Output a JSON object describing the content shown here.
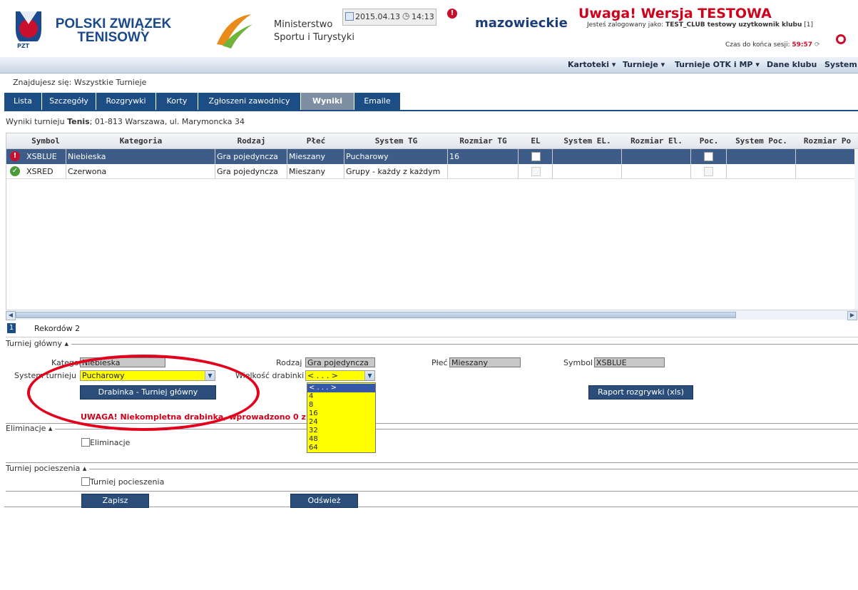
{
  "header": {
    "pzt_line1": "POLSKI ZWIĄZEK",
    "pzt_line2": "TENISOWY",
    "pzt_badge": "PZT",
    "ministry_line1": "Ministerstwo",
    "ministry_line2": "Sportu i Turystyki",
    "date": "2015.04.13",
    "time": "14:13",
    "region": "mazowieckie",
    "warning": "Uwaga! Wersja TESTOWA",
    "logged_prefix": "Jesteś zalogowany jako:",
    "logged_user": "TEST_CLUB testowy uzytkownik klubu",
    "logged_suffix": "[1]",
    "session_label": "Czas do końca sesji:",
    "session_time": "59:57"
  },
  "menu": [
    "Kartoteki ▾",
    "Turnieje ▾",
    "Turnieje OTK i MP ▾",
    "Dane klubu",
    "System"
  ],
  "breadcrumb": "Znajdujesz się: Wszystkie Turnieje",
  "tabs": [
    "Lista",
    "Szczegóły",
    "Rozgrywki",
    "Korty",
    "Zgłoszeni zawodnicy",
    "Wyniki",
    "Emaile"
  ],
  "tabs_active": "Wyniki",
  "info": {
    "prefix": "Wyniki turnieju ",
    "name": "Tenis",
    "suffix": "; 01-813 Warszawa, ul. Marymoncka 34"
  },
  "grid": {
    "columns": [
      "Symbol",
      "Kategoria",
      "Rodzaj",
      "Płeć",
      "System TG",
      "Rozmiar TG",
      "EL",
      "System EL.",
      "Rozmiar El.",
      "Poc.",
      "System Poc.",
      "Rozmiar Po"
    ],
    "rows": [
      {
        "status": "error",
        "symbol": "XSBLUE",
        "kategoria": "Niebieska",
        "rodzaj": "Gra pojedyncza",
        "plec": "Mieszany",
        "system_tg": "Pucharowy",
        "rozmiar_tg": "16"
      },
      {
        "status": "ok",
        "symbol": "XSRED",
        "kategoria": "Czerwona",
        "rodzaj": "Gra pojedyncza",
        "plec": "Mieszany",
        "system_tg": "Grupy - każdy z każdym",
        "rozmiar_tg": ""
      }
    ]
  },
  "pager": {
    "page": "1",
    "records": "Rekordów 2"
  },
  "main_tournament": {
    "legend": "Turniej główny ▴",
    "kategoria_label": "Kategoria",
    "kategoria_value": "Niebieska",
    "rodzaj_label": "Rodzaj",
    "rodzaj_value": "Gra pojedyncza",
    "plec_label": "Płeć",
    "plec_value": "Mieszany",
    "symbol_label": "Symbol",
    "symbol_value": "XSBLUE",
    "system_label": "System turnieju",
    "system_value": "Pucharowy",
    "size_label": "Wielkość drabinki",
    "size_value": "< . . . >",
    "drabinka_button": "Drabinka - Turniej główny",
    "raport_button": "Raport rozgrywki (xls)",
    "warning": "UWAGA! Niekompletna drabinka, wprowadzono 0 z 16"
  },
  "size_options": [
    "< . . . >",
    "4",
    "8",
    "16",
    "24",
    "32",
    "48",
    "64"
  ],
  "eliminacje": {
    "legend": "Eliminacje ▴",
    "checkbox_label": "Eliminacje"
  },
  "pocieszenia": {
    "legend": "Turniej pocieszenia ▴",
    "checkbox_label": "Turniej pocieszenia"
  },
  "buttons": {
    "save": "Zapisz",
    "refresh": "Odśwież"
  }
}
